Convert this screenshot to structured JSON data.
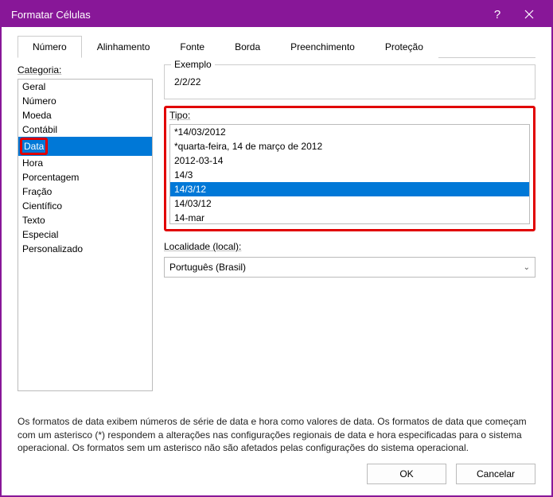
{
  "window": {
    "title": "Formatar Células"
  },
  "tabs": {
    "items": [
      {
        "label": "Número",
        "active": true
      },
      {
        "label": "Alinhamento",
        "active": false
      },
      {
        "label": "Fonte",
        "active": false
      },
      {
        "label": "Borda",
        "active": false
      },
      {
        "label": "Preenchimento",
        "active": false
      },
      {
        "label": "Proteção",
        "active": false
      }
    ]
  },
  "labels": {
    "category": "Categoria:",
    "example_legend": "Exemplo",
    "type": "Tipo:",
    "locale": "Localidade (local):"
  },
  "categories": [
    {
      "label": "Geral",
      "selected": false,
      "highlight": false
    },
    {
      "label": "Número",
      "selected": false,
      "highlight": false
    },
    {
      "label": "Moeda",
      "selected": false,
      "highlight": false
    },
    {
      "label": "Contábil",
      "selected": false,
      "highlight": false
    },
    {
      "label": "Data",
      "selected": true,
      "highlight": true
    },
    {
      "label": "Hora",
      "selected": false,
      "highlight": false
    },
    {
      "label": "Porcentagem",
      "selected": false,
      "highlight": false
    },
    {
      "label": "Fração",
      "selected": false,
      "highlight": false
    },
    {
      "label": "Científico",
      "selected": false,
      "highlight": false
    },
    {
      "label": "Texto",
      "selected": false,
      "highlight": false
    },
    {
      "label": "Especial",
      "selected": false,
      "highlight": false
    },
    {
      "label": "Personalizado",
      "selected": false,
      "highlight": false
    }
  ],
  "example": {
    "value": "2/2/22"
  },
  "types": [
    {
      "label": "*14/03/2012",
      "selected": false
    },
    {
      "label": "*quarta-feira, 14 de março de 2012",
      "selected": false
    },
    {
      "label": "2012-03-14",
      "selected": false
    },
    {
      "label": "14/3",
      "selected": false
    },
    {
      "label": "14/3/12",
      "selected": true
    },
    {
      "label": "14/03/12",
      "selected": false
    },
    {
      "label": "14-mar",
      "selected": false
    }
  ],
  "locale": {
    "value": "Português (Brasil)"
  },
  "description": "Os formatos de data exibem números de série de data e hora como valores de data. Os formatos de data que começam com um asterisco (*) respondem a alterações nas configurações regionais de data e hora especificadas para o sistema operacional. Os formatos sem um asterisco não são afetados pelas configurações do sistema operacional.",
  "buttons": {
    "ok": "OK",
    "cancel": "Cancelar"
  }
}
